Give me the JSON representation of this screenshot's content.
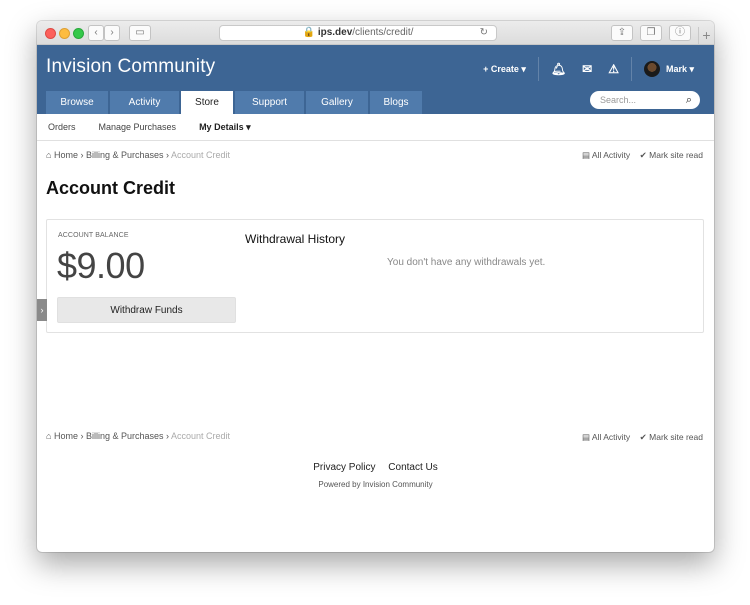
{
  "browser": {
    "url_domain": "ips.dev",
    "url_path": "/clients/credit/",
    "new_tab": "+"
  },
  "header": {
    "logo": "Invision Community",
    "create_label": "Create",
    "user_name": "Mark"
  },
  "nav": {
    "tabs": [
      {
        "label": "Browse"
      },
      {
        "label": "Activity"
      },
      {
        "label": "Store"
      },
      {
        "label": "Support"
      },
      {
        "label": "Gallery"
      },
      {
        "label": "Blogs"
      }
    ],
    "active_tab": "Store",
    "search_placeholder": "Search..."
  },
  "subnav": {
    "items": [
      "Orders",
      "Manage Purchases",
      "My Details"
    ]
  },
  "breadcrumb": {
    "home": "Home",
    "billing": "Billing & Purchases",
    "current": "Account Credit",
    "all_activity": "All Activity",
    "mark_read": "Mark site read"
  },
  "page": {
    "title": "Account Credit",
    "balance_label": "ACCOUNT BALANCE",
    "balance_value": "$9.00",
    "withdraw_button": "Withdraw Funds",
    "history_title": "Withdrawal History",
    "history_empty": "You don't have any withdrawals yet."
  },
  "footer": {
    "privacy": "Privacy Policy",
    "contact": "Contact Us",
    "powered": "Powered by Invision Community"
  },
  "colors": {
    "header_bg": "#3d6594",
    "tab_bg": "#507bac"
  }
}
